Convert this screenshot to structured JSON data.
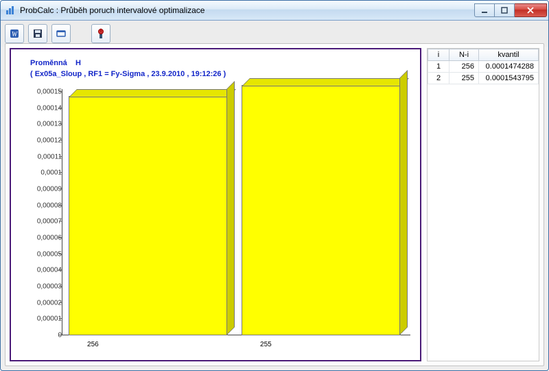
{
  "window": {
    "title": "ProbCalc : Průběh poruch intervalové optimalizace"
  },
  "toolbar": {
    "btn1": "refresh-icon",
    "btn2": "save-icon",
    "btn3": "window-icon",
    "btn4": "exit-icon"
  },
  "chart": {
    "title_label": "Proměnná",
    "title_var": "H",
    "subtitle": "( Ex05a_Sloup , RF1 = Fy-Sigma , 23.9.2010 , 19:12:26 )"
  },
  "table": {
    "headers": {
      "i": "i",
      "ni": "N-i",
      "kv": "kvantil"
    },
    "rows": [
      {
        "i": "1",
        "ni": "256",
        "kv": "0.0001474288"
      },
      {
        "i": "2",
        "ni": "255",
        "kv": "0.0001543795"
      }
    ]
  },
  "chart_data": {
    "type": "bar",
    "categories": [
      "256",
      "255"
    ],
    "values": [
      0.0001474288,
      0.0001543795
    ],
    "series": [
      {
        "name": "kvantil",
        "values": [
          0.0001474288,
          0.0001543795
        ]
      }
    ],
    "title": "Proměnná H",
    "subtitle": "( Ex05a_Sloup , RF1 = Fy-Sigma , 23.9.2010 , 19:12:26 )",
    "xlabel": "",
    "ylabel": "",
    "ylim": [
      0,
      0.00015
    ],
    "yticks": [
      0,
      1e-05,
      2e-05,
      3e-05,
      4e-05,
      5e-05,
      6e-05,
      7e-05,
      8e-05,
      9e-05,
      0.0001,
      0.00011,
      0.00012,
      0.00013,
      0.00014,
      0.00015
    ],
    "ytick_labels": [
      "0",
      "0,00001",
      "0,00002",
      "0,00003",
      "0,00004",
      "0,00005",
      "0,00006",
      "0,00007",
      "0,00008",
      "0,00009",
      "0,0001",
      "0,00011",
      "0,00012",
      "0,00013",
      "0,00014",
      "0,00015"
    ]
  }
}
